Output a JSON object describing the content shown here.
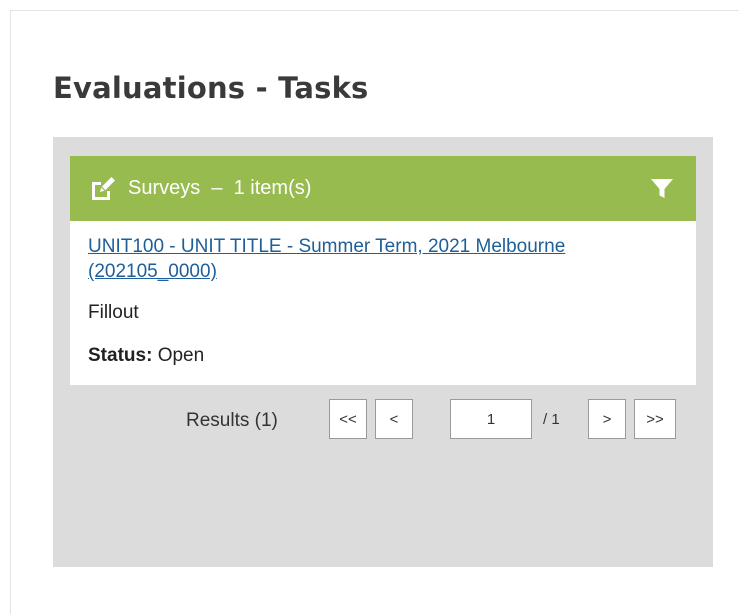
{
  "page": {
    "title": "Evaluations - Tasks"
  },
  "panel": {
    "header": {
      "icon": "edit-square-icon",
      "label": "Surveys",
      "separator": "–",
      "count_text": "1 item(s)",
      "filter_icon": "filter-icon",
      "bg_color": "#97bb4f"
    },
    "items": [
      {
        "link_text": "UNIT100 - UNIT TITLE - Summer Term, 2021 Melbourne (202105_0000)",
        "type": "Fillout",
        "status_label": "Status:",
        "status_value": "Open"
      }
    ],
    "pager": {
      "results_text": "Results (1)",
      "first_label": "<<",
      "prev_label": "<",
      "current_page": "1",
      "total_text": "/ 1",
      "next_label": ">",
      "last_label": ">>"
    }
  }
}
